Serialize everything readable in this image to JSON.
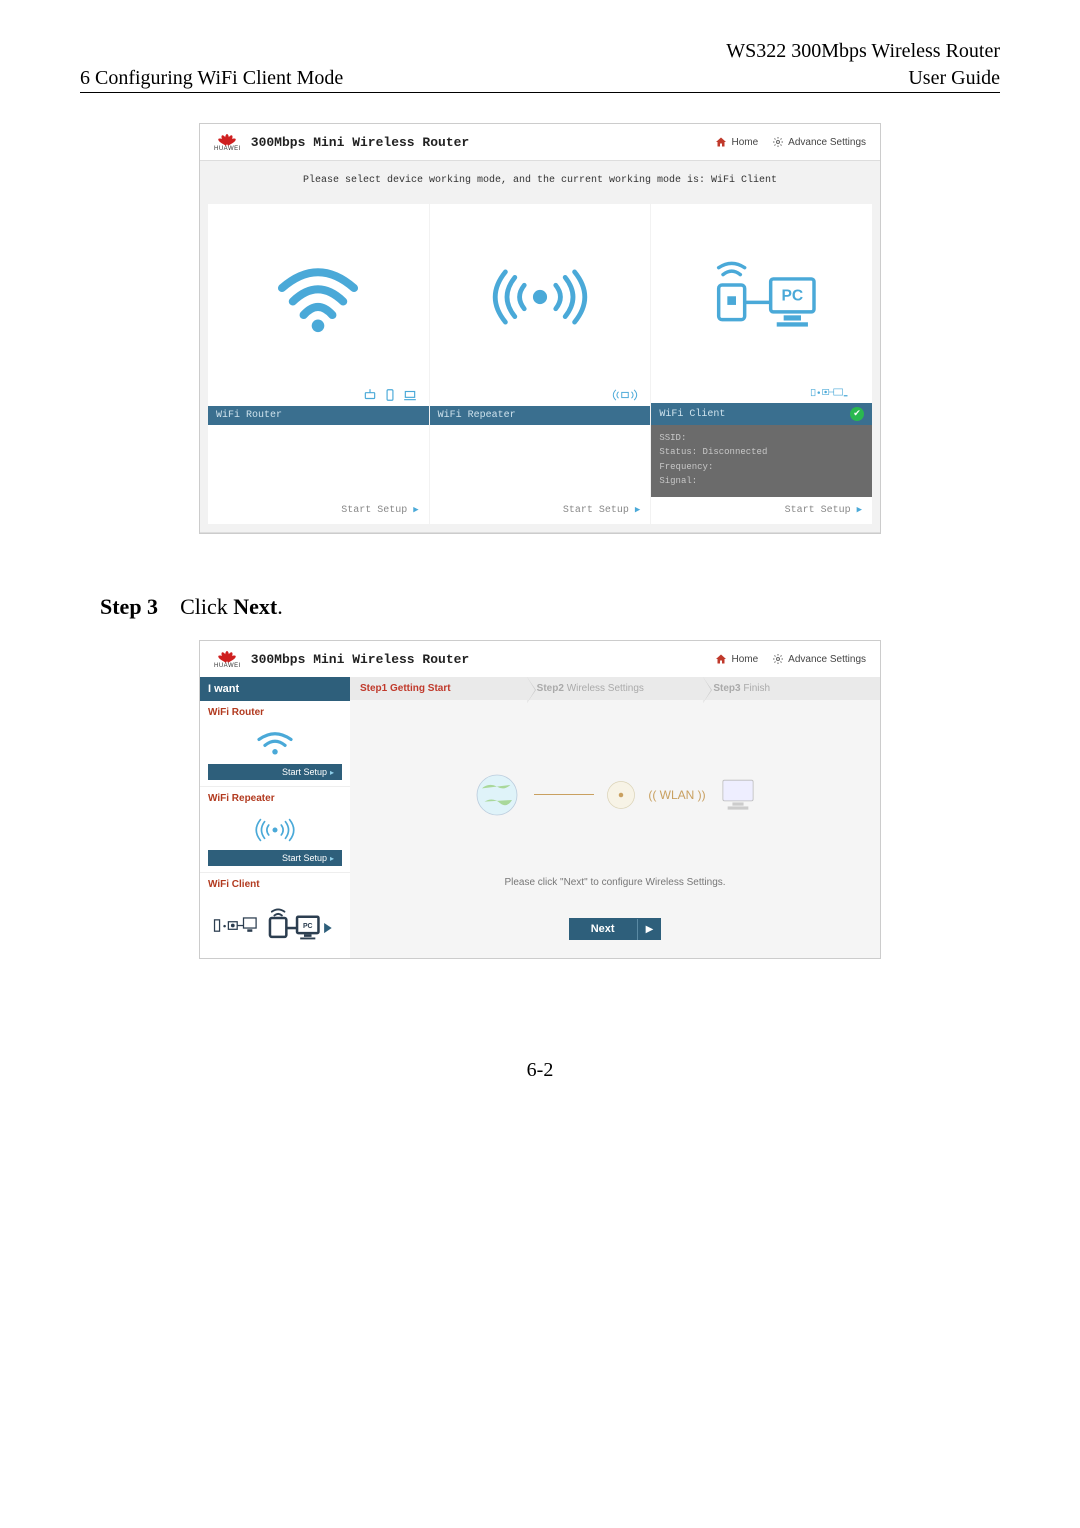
{
  "doc": {
    "product": "WS322 300Mbps Wireless Router",
    "section": "6 Configuring WiFi Client Mode",
    "guide": "User Guide",
    "page_number": "6-2",
    "step3": "Step 3",
    "step3_text": "Click ",
    "step3_bold": "Next",
    "step3_period": "."
  },
  "shot1": {
    "logo_text": "HUAWEI",
    "title": "300Mbps Mini Wireless Router",
    "home": "Home",
    "advance": "Advance Settings",
    "instruction": "Please select device working mode, and the current working mode is: WiFi Client",
    "cards": [
      {
        "label": "WiFi Router",
        "start": "Start Setup"
      },
      {
        "label": "WiFi Repeater",
        "start": "Start Setup"
      },
      {
        "label": "WiFi Client",
        "start": "Start Setup",
        "info_ssid": "SSID:",
        "info_status": "Status: Disconnected",
        "info_freq": "Frequency:",
        "info_signal": "Signal:"
      }
    ]
  },
  "shot2": {
    "logo_text": "HUAWEI",
    "title": "300Mbps Mini Wireless Router",
    "home": "Home",
    "advance": "Advance Settings",
    "iwant": "I want",
    "sidebar": [
      {
        "title": "WiFi Router",
        "start": "Start Setup"
      },
      {
        "title": "WiFi Repeater",
        "start": "Start Setup"
      },
      {
        "title": "WiFi Client"
      }
    ],
    "steps": [
      {
        "num": "Step1",
        "label": "Getting Start"
      },
      {
        "num": "Step2",
        "label": "Wireless Settings"
      },
      {
        "num": "Step3",
        "label": "Finish"
      }
    ],
    "wlan": "(( WLAN ))",
    "hint": "Please click \"Next\" to configure Wireless Settings.",
    "next": "Next"
  }
}
